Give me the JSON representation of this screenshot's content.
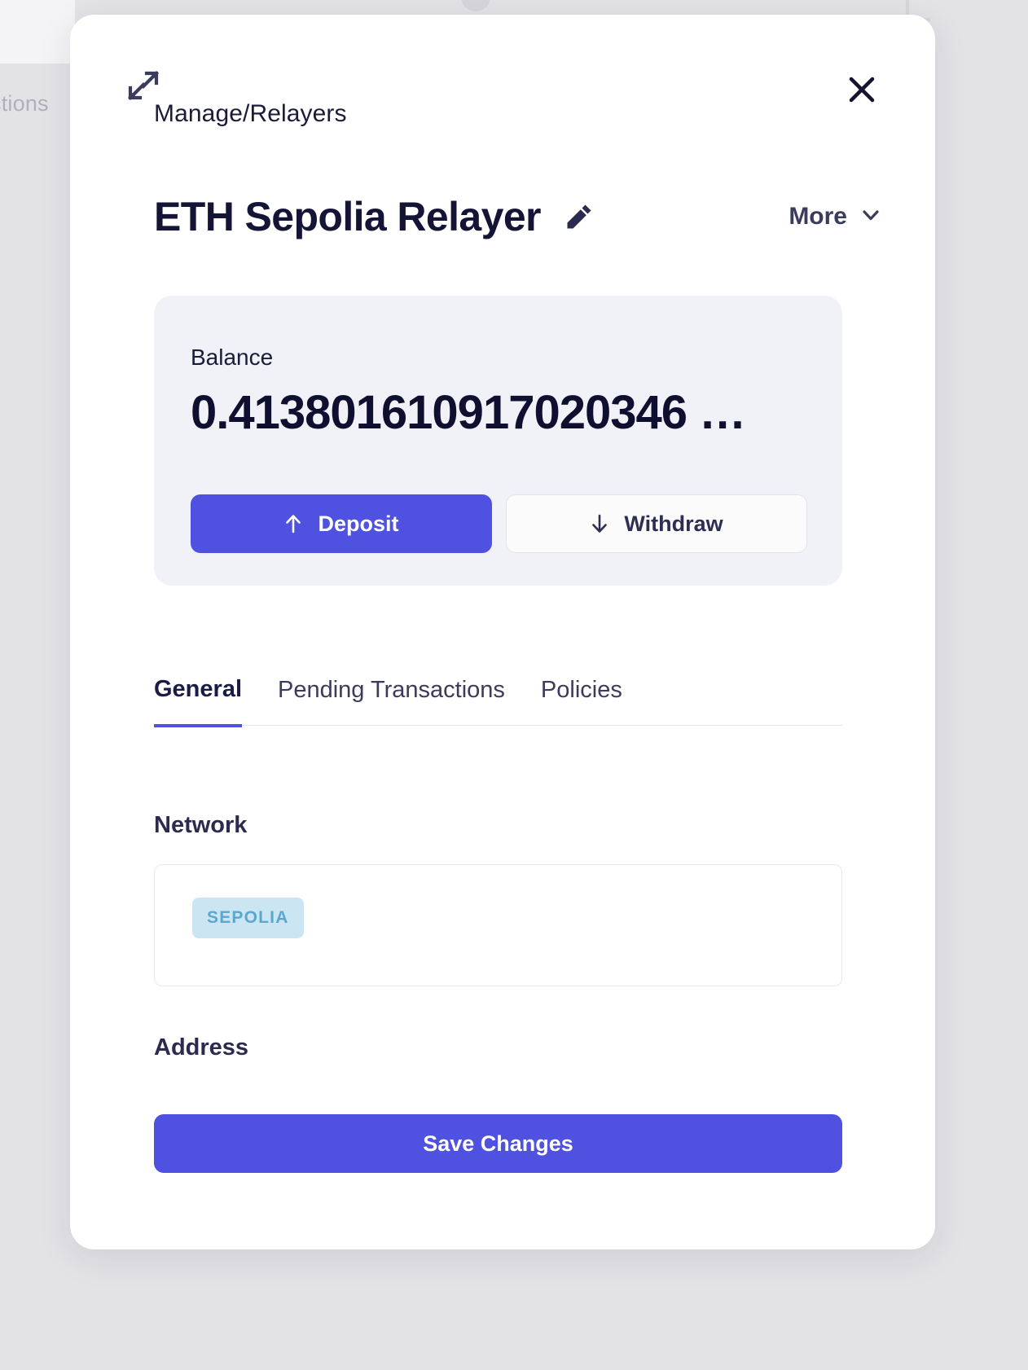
{
  "backdrop": {
    "partial_text": "ctions"
  },
  "modal": {
    "expand_icon": "expand-diagonal-icon",
    "close_icon": "close-icon",
    "breadcrumb": "Manage/Relayers",
    "title": "ETH Sepolia Relayer",
    "edit_icon": "pencil-icon",
    "more": {
      "label": "More",
      "chevron_icon": "chevron-down-icon"
    },
    "balance": {
      "label": "Balance",
      "value": "0.413801610917020346 …",
      "deposit": {
        "label": "Deposit",
        "icon": "arrow-up-icon"
      },
      "withdraw": {
        "label": "Withdraw",
        "icon": "arrow-down-icon"
      }
    },
    "tabs": [
      {
        "label": "General",
        "active": true
      },
      {
        "label": "Pending Transactions",
        "active": false
      },
      {
        "label": "Policies",
        "active": false
      }
    ],
    "general": {
      "network_label": "Network",
      "network_badge": "SEPOLIA",
      "address_label": "Address",
      "save_label": "Save Changes"
    }
  },
  "colors": {
    "accent": "#4F52E0",
    "title": "#141436",
    "card_bg": "#F1F2F7",
    "badge_bg": "#CBE5F2",
    "badge_text": "#5BA7CE",
    "backdrop": "#E3E3E6"
  }
}
